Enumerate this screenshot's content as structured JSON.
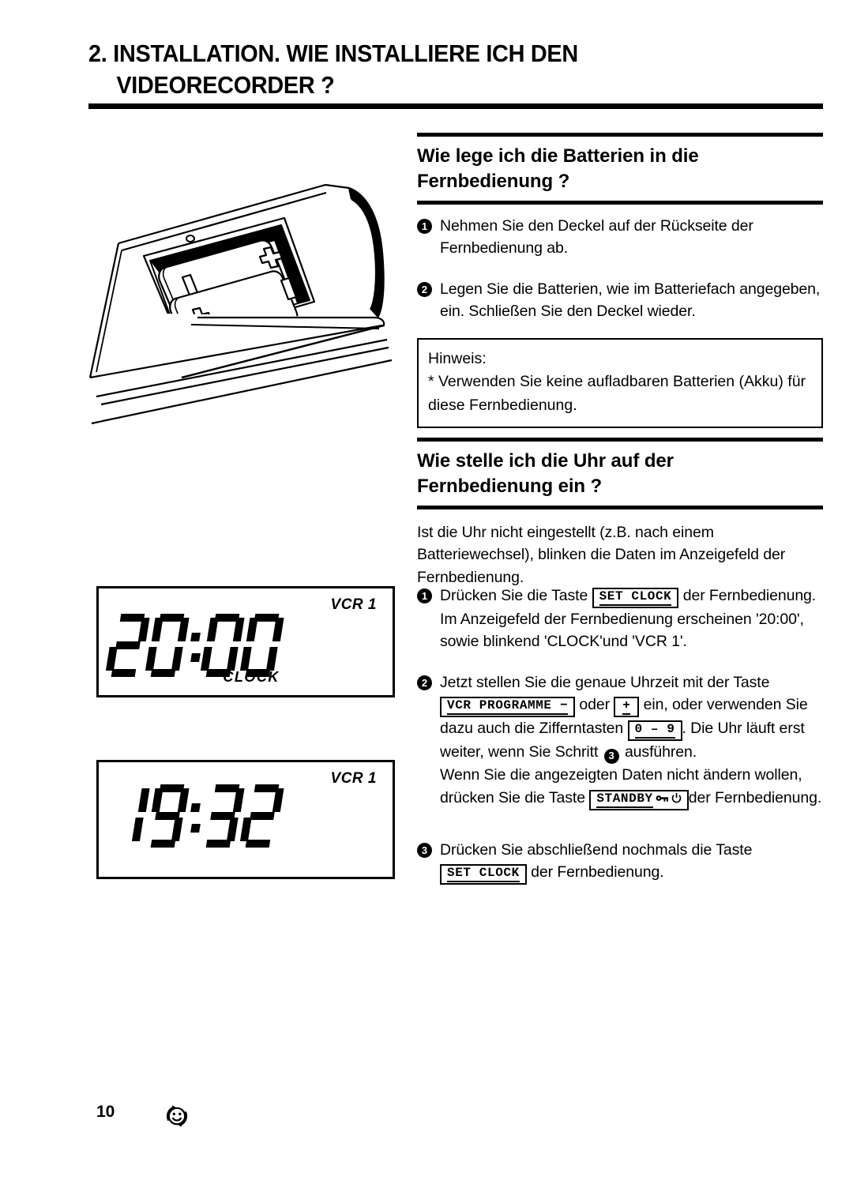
{
  "page": {
    "number": "10",
    "mark_icon": "recycle-smiley-icon"
  },
  "title": {
    "line1": "2. INSTALLATION. WIE INSTALLIERE ICH DEN",
    "line2": "VIDEORECORDER ?"
  },
  "illustration": {
    "name": "remote-control-battery-compartment",
    "description": "Fernbedienung mit geoeffnetem Batteriefach und zwei Batterien",
    "battery_marks": [
      "+",
      "-",
      "+",
      "-"
    ]
  },
  "sections": [
    {
      "heading": "Wie lege ich die Batterien in die\nFernbedienung ?",
      "heading_line1": "Wie lege ich die Batterien in die",
      "heading_line2": "Fernbedienung ?",
      "steps": [
        {
          "num": "1",
          "text": "Nehmen Sie den Deckel auf der Rückseite der Fernbedienung ab."
        },
        {
          "num": "2",
          "text": "Legen Sie die Batterien, wie im Batteriefach angegeben, ein. Schließen Sie den Deckel wieder."
        }
      ],
      "note": {
        "title": "Hinweis:",
        "text": "* Verwenden Sie keine aufladbaren Batterien (Akku) für diese Fernbedienung."
      }
    },
    {
      "heading_line1": "Wie stelle ich die Uhr auf der",
      "heading_line2": "Fernbedienung ein ?",
      "intro": "Ist die Uhr nicht eingestellt (z.B. nach einem Batteriewechsel), blinken die Daten im Anzeigefeld der Fernbedienung.",
      "steps": [
        {
          "num": "1",
          "part1": "Drücken Sie die Taste",
          "key1": "SET CLOCK",
          "part2": "der Fernbedienung. Im Anzeigefeld der Fernbedienung erscheinen '20:00', sowie blinkend 'CLOCK'und 'VCR 1'."
        },
        {
          "num": "2",
          "part1": "Jetzt stellen Sie die genaue Uhrzeit mit der Taste",
          "key1": "VCR PROGRAMME −",
          "part2": "oder",
          "key2": "+",
          "part3": "ein, oder verwenden Sie dazu auch die Zifferntasten",
          "key3": "0 – 9",
          "part4": ". Die Uhr läuft erst weiter, wenn Sie Schritt",
          "step_ref": "3",
          "part5": "ausführen.",
          "part6": "Wenn Sie die angezeigten Daten nicht ändern wollen, drücken Sie die Taste",
          "key4": "STANDBY",
          "key4_icons": [
            "key-icon",
            "power-icon"
          ],
          "part7": "der Fernbedienung."
        },
        {
          "num": "3",
          "part1": "Drücken Sie abschließend nochmals die Taste",
          "key1": "SET CLOCK",
          "part2": "der Fernbedienung."
        }
      ]
    }
  ],
  "displays": [
    {
      "name": "lcd-display-2000",
      "vcr_label": "VCR 1",
      "time": "20:00",
      "mode_label": "CLOCK"
    },
    {
      "name": "lcd-display-1932",
      "vcr_label": "VCR 1",
      "time": "19:32",
      "mode_label": ""
    }
  ],
  "colors": {
    "ink": "#000000",
    "paper": "#ffffff"
  }
}
